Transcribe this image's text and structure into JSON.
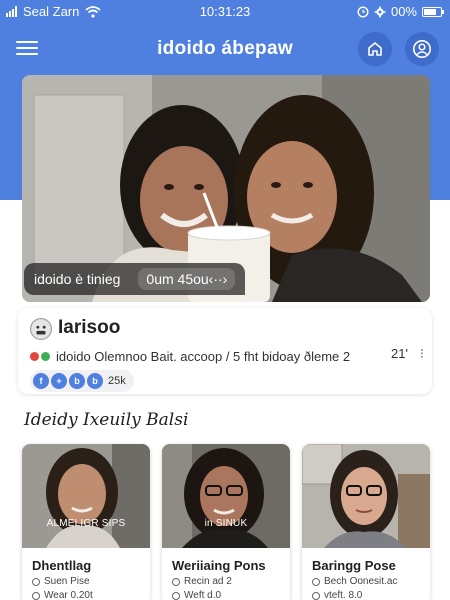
{
  "status_bar": {
    "carrier": "Seal Zarn",
    "time": "10:31:23",
    "battery": "00%",
    "icons": [
      "signal-icon",
      "wifi-icon",
      "alarm-icon",
      "gear-icon",
      "battery-icon"
    ]
  },
  "header": {
    "title": "idoido ábepaw",
    "icons": [
      "menu-icon",
      "home-icon",
      "profile-icon"
    ],
    "accent_color": "#4f7fdf"
  },
  "hero": {
    "caption_primary": "idoido è tinieg",
    "caption_secondary": "0um  45ou‹··›"
  },
  "profile": {
    "name": "Iarisoo",
    "meta_text": "idoido Olemnoo Bait. accoop / 5 fht bidoay ðleme 2",
    "meta_count": "21'",
    "meta_more": "⁝",
    "social_icons": [
      "f",
      "+",
      "b",
      "b"
    ],
    "social_count": "25k"
  },
  "section": {
    "title": "Ideidy Ixeuily Balsi"
  },
  "cards": [
    {
      "overlay": "ALMELIGR SIPS",
      "name": "Dhentllag",
      "line1": "Suen Pise",
      "line2": "Wear 0.20t"
    },
    {
      "overlay": "in SINUK",
      "name": "Weriiaing Pons",
      "line1": "Recin ad 2",
      "line2": "Weft d.0"
    },
    {
      "overlay": "",
      "name": "Baringg Pose",
      "line1": "Bech Oonesit.ac",
      "line2": "vteft. 8.0"
    }
  ]
}
